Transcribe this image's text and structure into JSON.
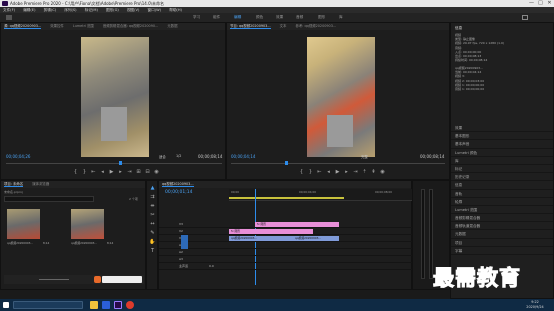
{
  "titlebar": {
    "title": "Adobe Premiere Pro 2020 - C:\\用户\\Fiona\\文档\\Adobe\\Premiere Pro\\14.0\\未命名",
    "minimize": "—",
    "maximize": "□",
    "close": "✕"
  },
  "menu": [
    "文件(F)",
    "编辑(E)",
    "剪辑(C)",
    "序列(S)",
    "标记(M)",
    "图形(G)",
    "视图(V)",
    "窗口(W)",
    "帮助(H)"
  ],
  "workspaces": [
    "学习",
    "组件",
    "编辑",
    "颜色",
    "效果",
    "音频",
    "图形",
    "库"
  ],
  "source_monitor": {
    "tabs": [
      "源: qq视频20200903...",
      "效果控件",
      "Lumetri 范围",
      "音频剪辑混合器: qq视频2020090...",
      "元数据"
    ],
    "timecode": "00;00;04;26",
    "fit": "适合",
    "ratio": "1/2",
    "duration": "00;00;08;14"
  },
  "program_monitor": {
    "tabs": [
      "节目: qq视频20200903...",
      "文本",
      "参考: qq视频20200903..."
    ],
    "timecode": "00;00;04;14",
    "fit": "完整",
    "duration": "00;00;08;14"
  },
  "info_panel": {
    "title": "信息",
    "lines": [
      "视频",
      "类型: 静止图像",
      "视频: 29.97 fps, 720 x 1280 (1.0)",
      "音频:",
      "入点: 00;00;00;00",
      "出点: 00;00;08;13",
      "持续时间: 00;00;08;14"
    ],
    "seq_title": "qq视频20200903...",
    "seq_lines": [
      "当前: 00;00;04;14",
      "视频 3:",
      "视频 2: 00;00;03;00",
      "视频 1: 00;00;00;00",
      "音频 1: 00;00;00;00"
    ]
  },
  "right_panels": [
    "效果",
    "基本图形",
    "基本声音",
    "Lumetri 颜色",
    "库",
    "标记",
    "历史记录",
    "信息",
    "音轨",
    "轮廓",
    "Lumetri 范围",
    "音频剪辑混合器",
    "音频轨道混合器",
    "元数据",
    "项目",
    "字幕"
  ],
  "project_panel": {
    "tabs": [
      "项目: 未命名",
      "媒体浏览器"
    ],
    "path": "未命名.prproj",
    "count": "2 个项",
    "items": [
      {
        "name": "qq视频20200903...",
        "dur": "8;14"
      },
      {
        "name": "qq视频20200903...",
        "dur": "8;14"
      }
    ]
  },
  "timeline": {
    "tab": "qq视频20200903...",
    "timecode": "00;00;01;14",
    "ruler": [
      "00;00",
      "00;00;04;00",
      "00;00;08;00"
    ],
    "tracks": [
      "V3",
      "V2",
      "V1",
      "A1",
      "A2",
      "A3",
      "主声道"
    ],
    "master_value": "0.0",
    "clips": [
      {
        "label": "fx 图形",
        "track": "V3"
      },
      {
        "label": "fx 图形",
        "track": "V2"
      },
      {
        "label": "qq视频20200903...",
        "track": "V1"
      },
      {
        "label": "qq视频20200903...",
        "track": "V1b"
      }
    ]
  },
  "taskbar": {
    "time": "9:22",
    "date": "2020/9/24"
  },
  "watermark": "最需教育",
  "colors": {
    "accent": "#2d8ceb",
    "clip_pink": "#e88fd8",
    "clip_blue": "#7f9ad8",
    "taskbar": "#0f2a44"
  }
}
